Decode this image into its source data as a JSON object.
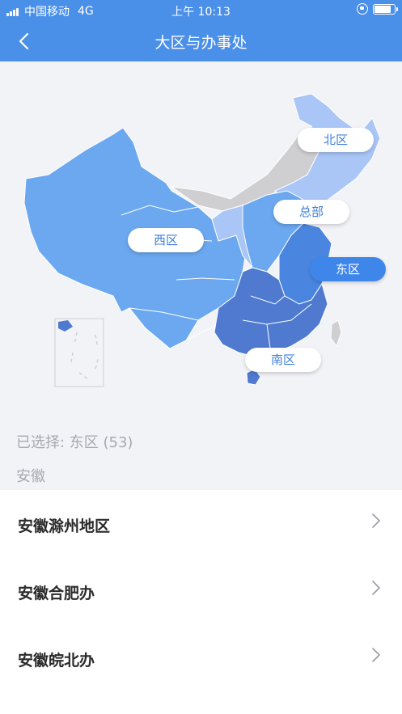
{
  "status_bar": {
    "carrier": "中国移动",
    "network": "4G",
    "time": "上午 10:13"
  },
  "nav": {
    "title": "大区与办事处",
    "back_icon": "chevron-left-icon"
  },
  "map": {
    "regions": [
      {
        "name": "北区",
        "selected": false
      },
      {
        "name": "总部",
        "selected": false
      },
      {
        "name": "西区",
        "selected": false
      },
      {
        "name": "东区",
        "selected": true
      },
      {
        "name": "南区",
        "selected": false
      }
    ],
    "colors": {
      "west": "#6ba8ef",
      "north": "#a9c6f6",
      "east": "#4a86e0",
      "south": "#4f7ad0",
      "unassigned": "#cfcfd1"
    }
  },
  "selection": {
    "selected_text": "已选择: 东区 (53)",
    "province": "安徽"
  },
  "offices": [
    {
      "name": "安徽滁州地区"
    },
    {
      "name": "安徽合肥办"
    },
    {
      "name": "安徽皖北办"
    }
  ]
}
